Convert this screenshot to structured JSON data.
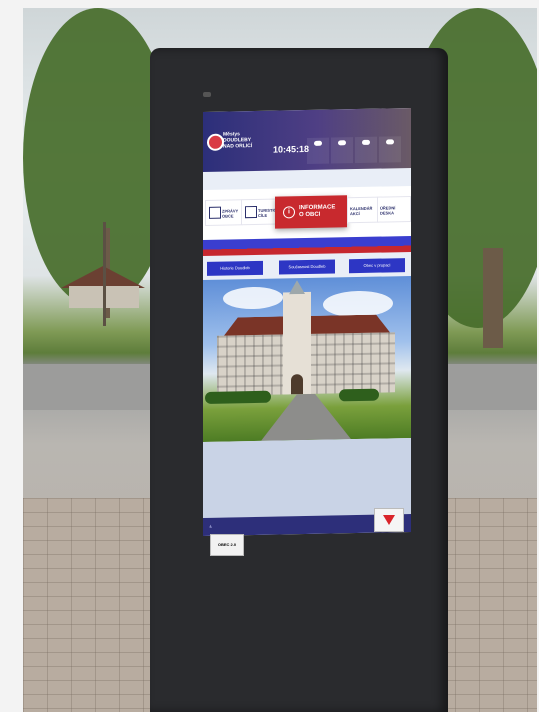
{
  "kiosk": {
    "brand_name": "Městys\nDOUDLEBY\nNAD ORLICÍ",
    "clock": "10:45:18",
    "date": "",
    "weather_days": [
      "",
      "",
      "",
      ""
    ],
    "menu_tiles": [
      "ZPRÁVY OBCE",
      "TURISTICKÉ CÍLE",
      "KALENDÁŘ AKCÍ",
      "ÚŘEDNÍ DESKA"
    ],
    "main_tile": "INFORMACE\nO OBCI",
    "sub_buttons": [
      "Historie Doudleb",
      "Současnost Doudleb",
      "Obec v propaci"
    ],
    "sticker_label": "OBEC 2.0"
  },
  "colors": {
    "topbar": "#2c2f7a",
    "accent_red": "#c8292e",
    "nav_blue": "#2d36c4",
    "kiosk_body": "#2a2b2e"
  }
}
